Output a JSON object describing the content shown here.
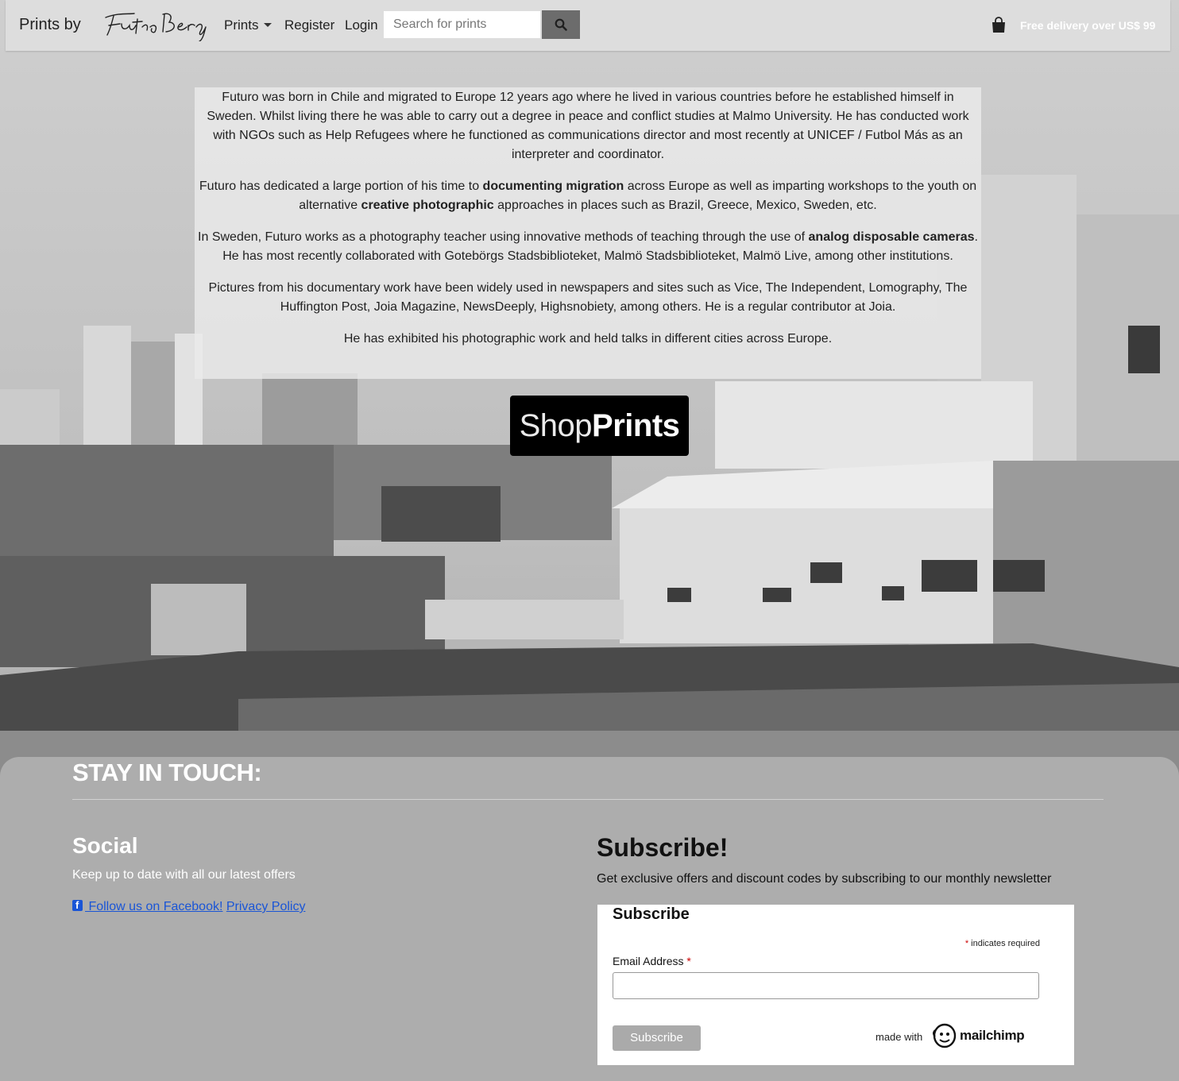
{
  "navbar": {
    "brand": "Prints by",
    "logo_text": "Futuro Berg",
    "menu": {
      "prints": "Prints",
      "register": "Register",
      "login": "Login"
    },
    "search": {
      "placeholder": "Search for prints"
    },
    "delivery": "Free delivery over US$ 99"
  },
  "about": {
    "p1": "Futuro was born in Chile and migrated to Europe 12 years ago where he lived in various countries before he established himself in Sweden. Whilst living there he was able to carry out a degree in peace and conflict studies at Malmo University. He has conducted work with NGOs such as Help Refugees where he functioned as communications director and most recently at UNICEF / Futbol Más as an interpreter and coordinator.",
    "p2": {
      "a": "Futuro has dedicated a large portion of his time to ",
      "b": "documenting migration",
      "c": " across Europe as well as imparting workshops to the youth on alternative ",
      "d": "creative photographic",
      "e": " approaches in places such as Brazil, Greece, Mexico, Sweden, etc."
    },
    "p3": {
      "a": "In Sweden, Futuro works as a photography teacher using innovative methods of teaching through the use of ",
      "b": "analog disposable cameras",
      "c": ". He has most recently collaborated with Gotebörgs Stadsbiblioteket, Malmö Stadsbiblioteket, Malmö Live, among other institutions."
    },
    "p4": "Pictures from his documentary work have been widely used in newspapers and sites such as Vice, The Independent, Lomography, The Huffington Post, Joia Magazine, NewsDeeply, Highsnobiety, among others. He is a regular contributor at Joia.",
    "p5": "He has exhibited his photographic work and held talks in different cities across Europe."
  },
  "shop": {
    "light": "Shop",
    "bold": "Prints"
  },
  "footer": {
    "heading": "STAY IN TOUCH:",
    "social": {
      "title": "Social",
      "text": "Keep up to date with all our latest offers",
      "facebook": " Follow us on Facebook!",
      "privacy": "Privacy Policy"
    },
    "subscribe": {
      "title": "Subscribe!",
      "text": "Get exclusive offers and discount codes by subscribing to our monthly newsletter",
      "form": {
        "title": "Subscribe",
        "required_note": "indicates required",
        "email_label": "Email Address",
        "button": "Subscribe",
        "made_with": "made with",
        "brand": "mailchimp"
      }
    }
  },
  "colors": {
    "link": "#1a55d6",
    "required": "#cc0000",
    "search_button": "#6c6c6c"
  },
  "icons": [
    "search-icon",
    "shopping-bag-icon",
    "facebook-icon",
    "mailchimp-icon"
  ]
}
